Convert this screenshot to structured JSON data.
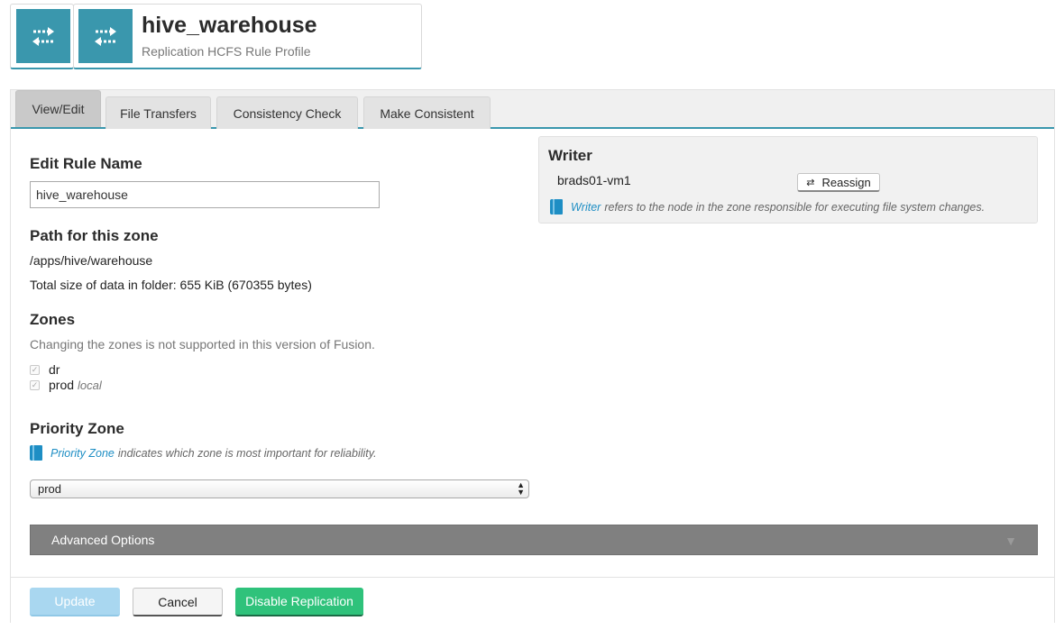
{
  "header": {
    "title": "hive_warehouse",
    "subtitle": "Replication HCFS Rule Profile",
    "icon": "replication-arrows-icon",
    "accent_color": "#3a97ad"
  },
  "tabs": [
    {
      "label": "View/Edit",
      "active": true
    },
    {
      "label": "File Transfers",
      "active": false
    },
    {
      "label": "Consistency Check",
      "active": false
    },
    {
      "label": "Make Consistent",
      "active": false
    }
  ],
  "edit_rule": {
    "heading": "Edit Rule Name",
    "value": "hive_warehouse"
  },
  "path": {
    "heading": "Path for this zone",
    "value": "/apps/hive/warehouse",
    "size_text": "Total size of data in folder: 655 KiB (670355 bytes)"
  },
  "zones": {
    "heading": "Zones",
    "note": "Changing the zones is not supported in this version of Fusion.",
    "items": [
      {
        "name": "dr",
        "checked": true,
        "tag": ""
      },
      {
        "name": "prod",
        "checked": true,
        "tag": "local"
      }
    ]
  },
  "priority": {
    "heading": "Priority Zone",
    "info_link": "Priority Zone",
    "info_text": "indicates which zone is most important for reliability.",
    "selected": "prod"
  },
  "advanced": {
    "label": "Advanced Options"
  },
  "writer": {
    "heading": "Writer",
    "node": "brads01-vm1",
    "reassign_label": "Reassign",
    "info_link": "Writer",
    "info_text": "refers to the node in the zone responsible for executing file system changes."
  },
  "footer": {
    "update_label": "Update",
    "cancel_label": "Cancel",
    "disable_label": "Disable Replication"
  }
}
